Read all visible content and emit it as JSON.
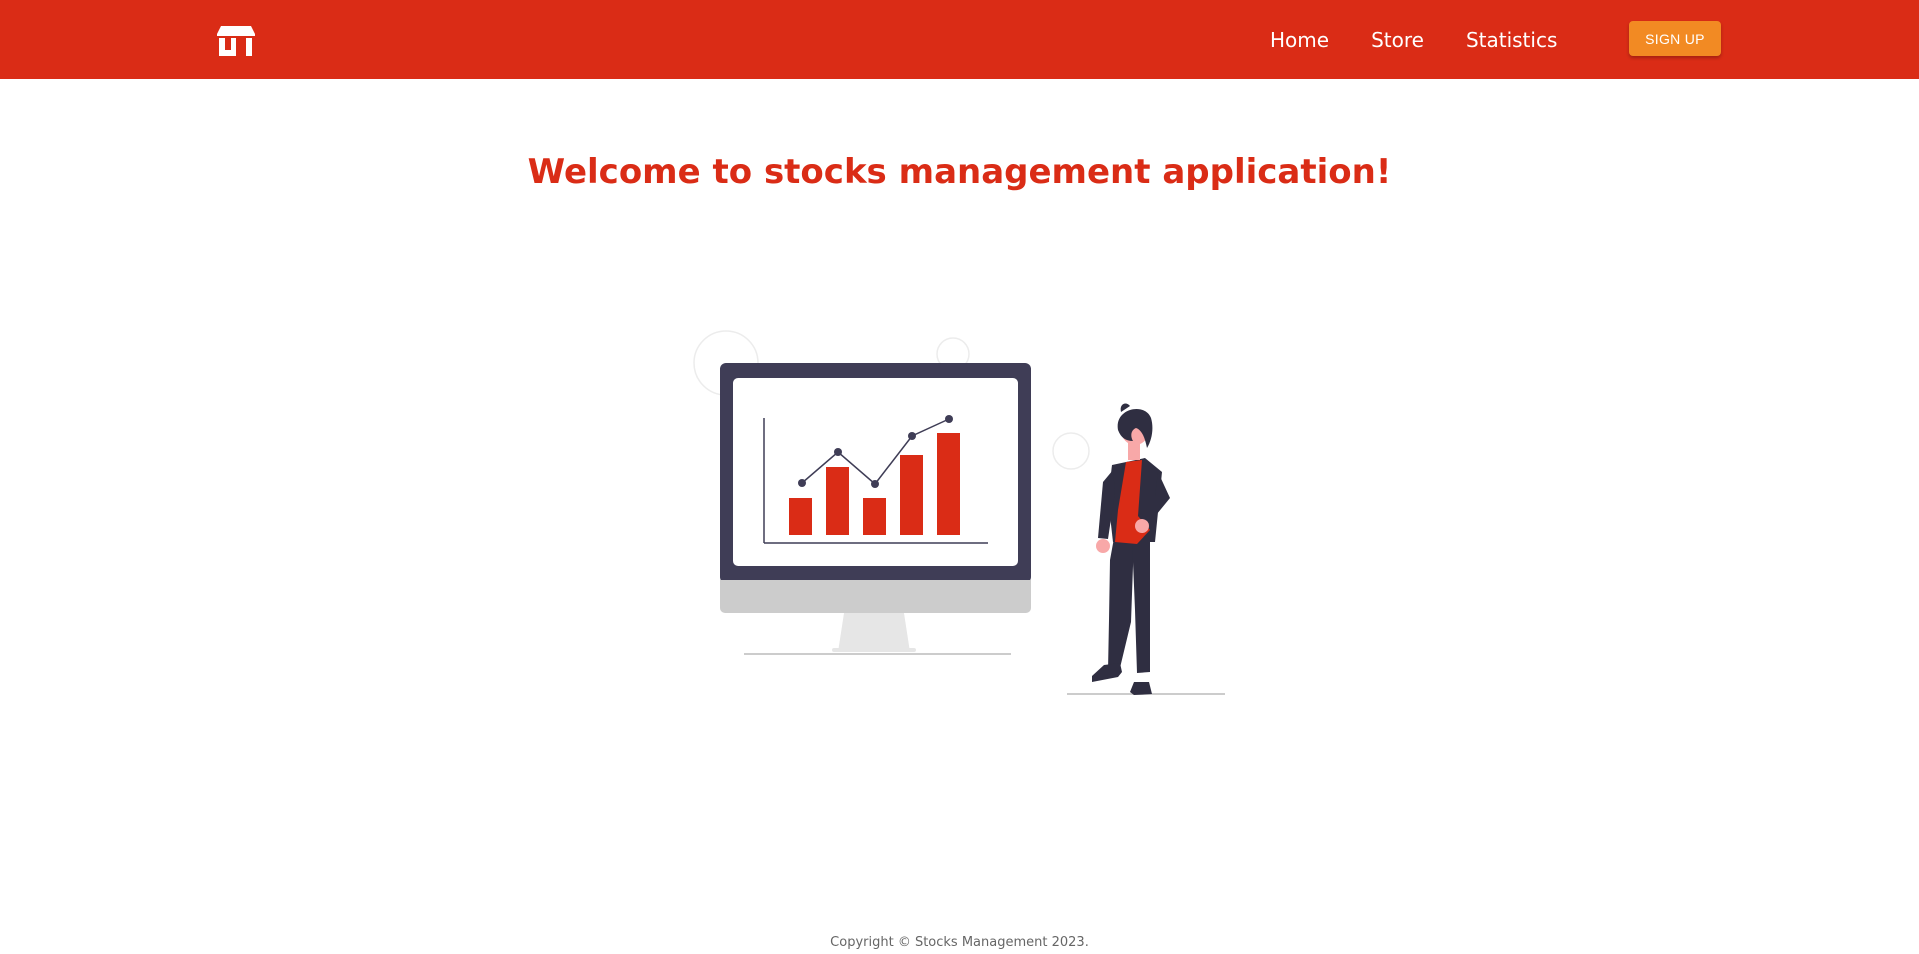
{
  "navbar": {
    "logo_icon": "store-icon",
    "links": [
      {
        "label": "Home"
      },
      {
        "label": "Store"
      },
      {
        "label": "Statistics"
      }
    ],
    "signup_label": "SIGN UP"
  },
  "main": {
    "title": "Welcome to stocks management application!",
    "illustration": "analytics-illustration"
  },
  "footer": {
    "copyright": "Copyright © Stocks Management 2023."
  },
  "colors": {
    "brand": "#da2c16",
    "signup": "#f28a23",
    "monitor_frame": "#3f3d56",
    "ground": "#cccccc"
  }
}
